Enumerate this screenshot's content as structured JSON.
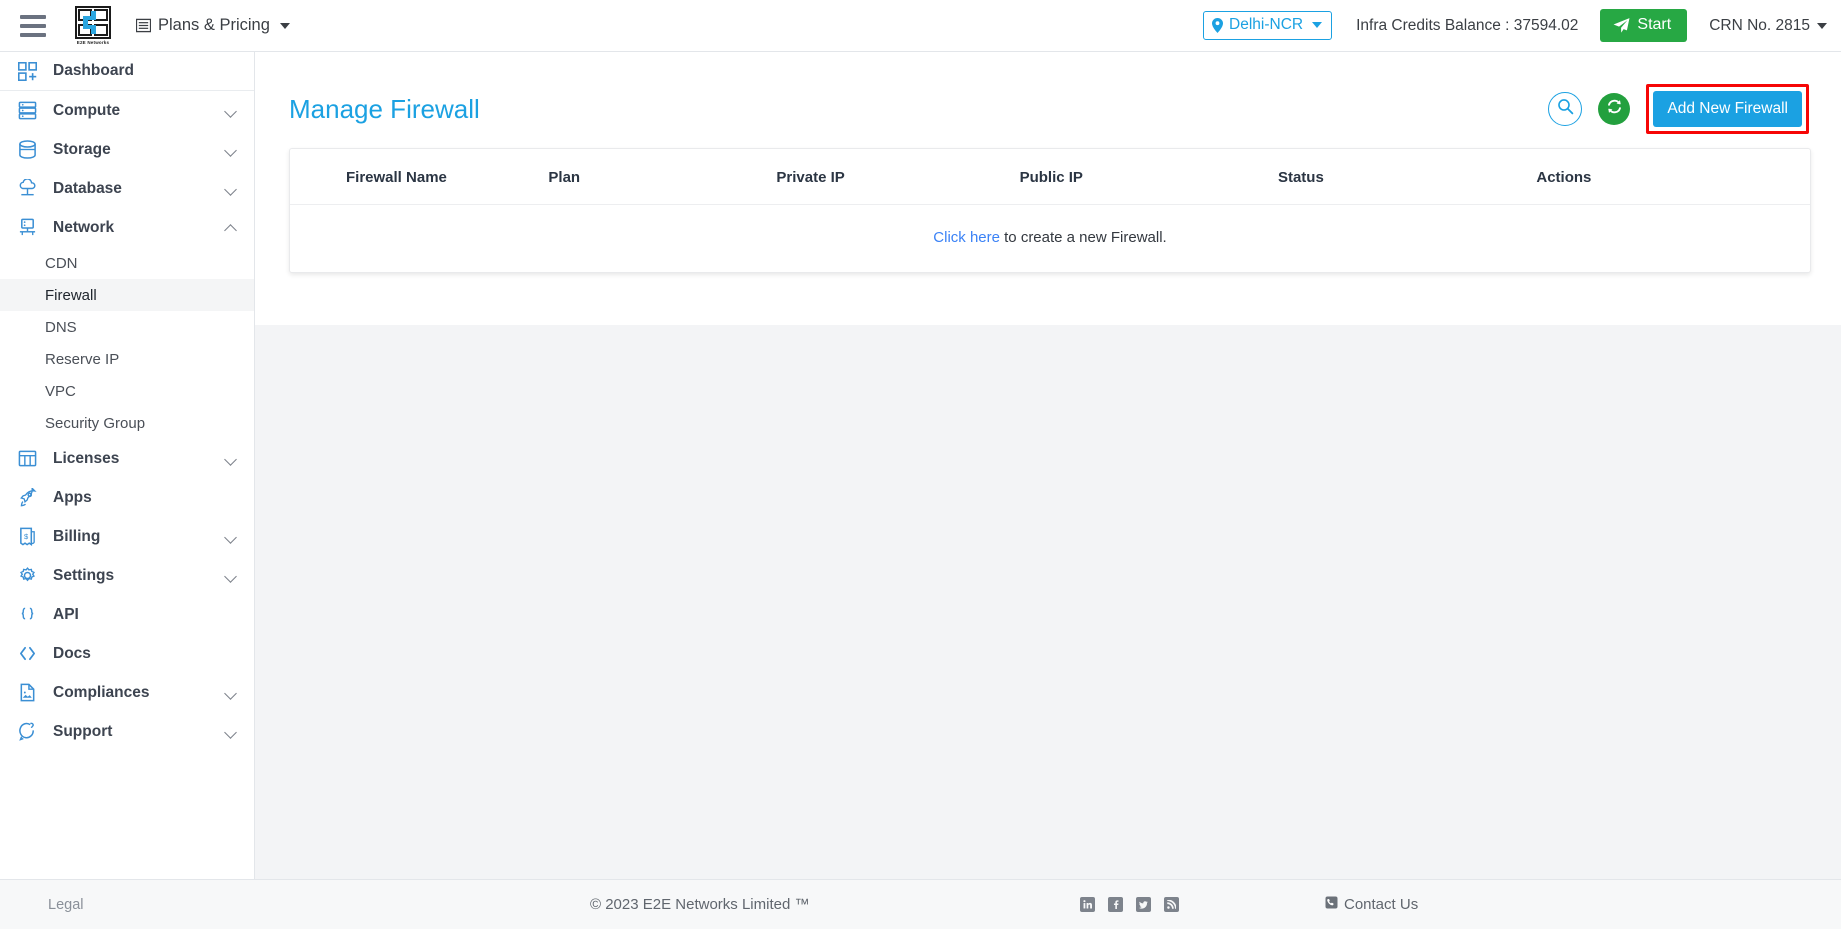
{
  "topbar": {
    "menu_icon": "hamburger-icon",
    "logo_caption": "E2E Networks",
    "plans_label": "Plans & Pricing",
    "region_label": "Delhi-NCR",
    "credits_label": "Infra Credits Balance : 37594.02",
    "start_label": "Start",
    "crn_label": "CRN No. 2815"
  },
  "sidebar": {
    "items": [
      {
        "label": "Dashboard",
        "icon": "dashboard-icon",
        "expandable": false,
        "expanded": false
      },
      {
        "label": "Compute",
        "icon": "server-icon",
        "expandable": true,
        "expanded": false
      },
      {
        "label": "Storage",
        "icon": "database-disk-icon",
        "expandable": true,
        "expanded": false
      },
      {
        "label": "Database",
        "icon": "cloud-database-icon",
        "expandable": true,
        "expanded": false
      },
      {
        "label": "Network",
        "icon": "network-icon",
        "expandable": true,
        "expanded": true
      },
      {
        "label": "Licenses",
        "icon": "licenses-grid-icon",
        "expandable": true,
        "expanded": false
      },
      {
        "label": "Apps",
        "icon": "rocket-icon",
        "expandable": false,
        "expanded": false
      },
      {
        "label": "Billing",
        "icon": "invoice-dollar-icon",
        "expandable": true,
        "expanded": false
      },
      {
        "label": "Settings",
        "icon": "gear-icon",
        "expandable": true,
        "expanded": false
      },
      {
        "label": "API",
        "icon": "braces-icon",
        "expandable": false,
        "expanded": false
      },
      {
        "label": "Docs",
        "icon": "code-angle-icon",
        "expandable": false,
        "expanded": false
      },
      {
        "label": "Compliances",
        "icon": "document-icon",
        "expandable": true,
        "expanded": false
      },
      {
        "label": "Support",
        "icon": "support-chat-icon",
        "expandable": true,
        "expanded": false
      }
    ],
    "network_subitems": [
      {
        "label": "CDN",
        "active": false
      },
      {
        "label": "Firewall",
        "active": true
      },
      {
        "label": "DNS",
        "active": false
      },
      {
        "label": "Reserve IP",
        "active": false
      },
      {
        "label": "VPC",
        "active": false
      },
      {
        "label": "Security Group",
        "active": false
      }
    ]
  },
  "main": {
    "title": "Manage Firewall",
    "search_icon": "search-icon",
    "refresh_icon": "refresh-icon",
    "add_button_label": "Add New Firewall",
    "table": {
      "columns": [
        "Firewall Name",
        "Plan",
        "Private IP",
        "Public IP",
        "Status",
        "Actions"
      ],
      "rows": [],
      "empty_link_text": "Click here",
      "empty_rest_text": " to create a new Firewall."
    }
  },
  "footer": {
    "legal": "Legal",
    "copyright": "© 2023 E2E Networks Limited ™",
    "social": [
      {
        "name": "linkedin-icon",
        "glyph": "in"
      },
      {
        "name": "facebook-icon",
        "glyph": "f"
      },
      {
        "name": "twitter-icon",
        "glyph": "ᵛ"
      },
      {
        "name": "rss-icon",
        "glyph": "◠"
      }
    ],
    "contact": "Contact Us"
  },
  "colors": {
    "accent_blue": "#1ba1e2",
    "green": "#27a844",
    "highlight_red": "#f60606",
    "link_blue": "#3b82f6"
  }
}
